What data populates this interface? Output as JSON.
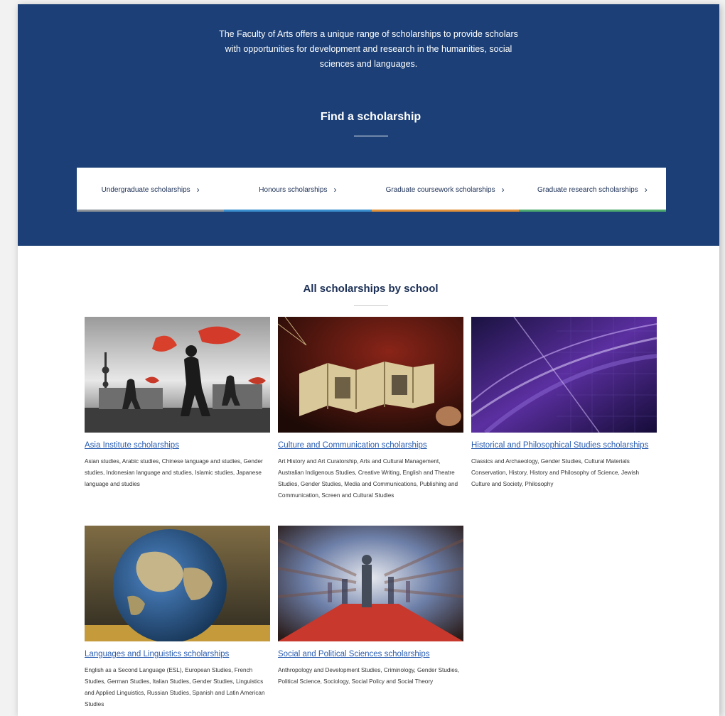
{
  "hero": {
    "intro": "The Faculty of Arts offers a unique range of scholarships to provide scholars with opportunities for development and research in the humanities, social sciences and languages.",
    "find_title": "Find a scholarship"
  },
  "tabs": [
    {
      "label": "Undergraduate scholarships",
      "color": "#8d9399"
    },
    {
      "label": "Honours scholarships",
      "color": "#3a8fcf"
    },
    {
      "label": "Graduate coursework scholarships",
      "color": "#e0913a"
    },
    {
      "label": "Graduate research scholarships",
      "color": "#4caa6e"
    }
  ],
  "section_title": "All scholarships by school",
  "schools": [
    {
      "title": "Asia Institute scholarships",
      "desc": "Asian studies, Arabic studies, Chinese language and studies, Gender studies, Indonesian language and studies, Islamic studies, Japanese language and studies",
      "image": "fan-dancers-skyline"
    },
    {
      "title": "Culture and Communication scholarships",
      "desc": "Art History and Art Curatorship, Arts and Cultural Management, Australian Indigenous Studies, Creative Writing, English and Theatre Studies, Gender Studies, Media and Communications, Publishing and Communication, Screen and Cultural Studies",
      "image": "folded-manuscript"
    },
    {
      "title": "Historical and Philosophical Studies scholarships",
      "desc": "Classics and Archaeology, Gender Studies, Cultural Materials Conservation, History, History and Philosophy of Science, Jewish Culture and Society, Philosophy",
      "image": "purple-light-streaks"
    },
    {
      "title": "Languages and Linguistics scholarships",
      "desc": "English as a Second Language (ESL), European Studies, French Studies, German Studies, Italian Studies, Gender Studies, Linguistics and Applied Linguistics, Russian Studies, Spanish and Latin American Studies",
      "image": "cracked-globe"
    },
    {
      "title": "Social and Political Sciences scholarships",
      "desc": "Anthropology and Development Studies, Criminology, Gender Studies, Political Science, Sociology, Social Policy and Social Theory",
      "image": "motion-blur-crowd"
    }
  ]
}
